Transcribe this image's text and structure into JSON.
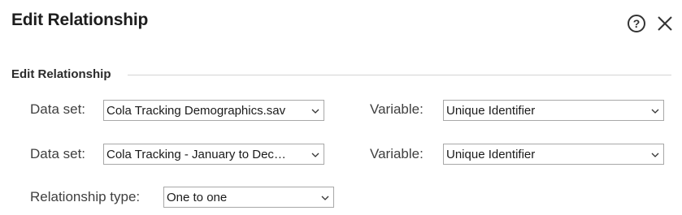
{
  "dialog": {
    "title": "Edit Relationship"
  },
  "section": {
    "label": "Edit Relationship"
  },
  "rows": [
    {
      "dataset_label": "Data set:",
      "dataset_value": "Cola Tracking Demographics.sav",
      "variable_label": "Variable:",
      "variable_value": "Unique Identifier"
    },
    {
      "dataset_label": "Data set:",
      "dataset_value": "Cola Tracking - January to Dec…",
      "variable_label": "Variable:",
      "variable_value": "Unique Identifier"
    }
  ],
  "relationship": {
    "label": "Relationship type:",
    "value": "One to one"
  },
  "icons": {
    "help": "help-circle-icon",
    "close": "close-icon",
    "dropdown": "chevron-down-icon"
  }
}
